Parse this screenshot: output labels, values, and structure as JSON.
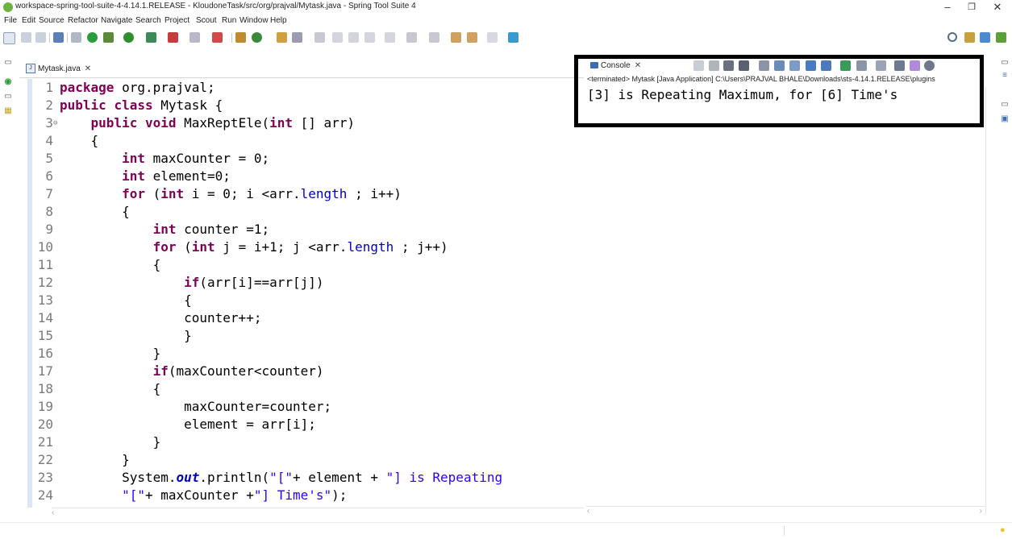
{
  "window": {
    "title": "workspace-spring-tool-suite-4-4.14.1.RELEASE - KloudoneTask/src/org/prajval/Mytask.java - Spring Tool Suite 4",
    "minimize": "–",
    "maximize": "❐",
    "close": "✕"
  },
  "menu": [
    "File",
    "Edit",
    "Source",
    "Refactor",
    "Navigate",
    "Search",
    "Project",
    "Scout",
    "Run",
    "Window",
    "Help"
  ],
  "editor": {
    "tab_label": "Mytask.java",
    "tab_close": "✕",
    "lines": [
      {
        "n": "1",
        "code": "package org.prajval;"
      },
      {
        "n": "2",
        "code": "public class Mytask {"
      },
      {
        "n": "3",
        "code": "    public void MaxReptEle(int [] arr)"
      },
      {
        "n": "4",
        "code": "    {"
      },
      {
        "n": "5",
        "code": "        int maxCounter = 0;"
      },
      {
        "n": "6",
        "code": "        int element=0;"
      },
      {
        "n": "7",
        "code": "        for (int i = 0; i <arr.length ; i++)"
      },
      {
        "n": "8",
        "code": "        {"
      },
      {
        "n": "9",
        "code": "            int counter =1;"
      },
      {
        "n": "10",
        "code": "            for (int j = i+1; j <arr.length ; j++)"
      },
      {
        "n": "11",
        "code": "            {"
      },
      {
        "n": "12",
        "code": "                if(arr[i]==arr[j])"
      },
      {
        "n": "13",
        "code": "                {"
      },
      {
        "n": "14",
        "code": "                counter++;"
      },
      {
        "n": "15",
        "code": "                }"
      },
      {
        "n": "16",
        "code": "            }"
      },
      {
        "n": "17",
        "code": "            if(maxCounter<counter)"
      },
      {
        "n": "18",
        "code": "            {"
      },
      {
        "n": "19",
        "code": "                maxCounter=counter;"
      },
      {
        "n": "20",
        "code": "                element = arr[i];"
      },
      {
        "n": "21",
        "code": "            }"
      },
      {
        "n": "22",
        "code": "        }"
      },
      {
        "n": "23",
        "code": "        System.out.println(\"[\"+ element + \"] is Repeating"
      },
      {
        "n": "24",
        "code": "        \"[\"+ maxCounter +\"] Time's\");"
      }
    ]
  },
  "console": {
    "tab_label": "Console",
    "tab_close": "✕",
    "status": "<terminated> Mytask [Java Application] C:\\Users\\PRAJVAL BHALE\\Downloads\\sts-4.14.1.RELEASE\\plugins",
    "output": "[3] is Repeating Maximum, for [6] Time's"
  },
  "colors": {
    "highlight_box": "#000000",
    "keyword": "#7f0055",
    "field": "#0000c0",
    "string": "#2a00ff"
  }
}
